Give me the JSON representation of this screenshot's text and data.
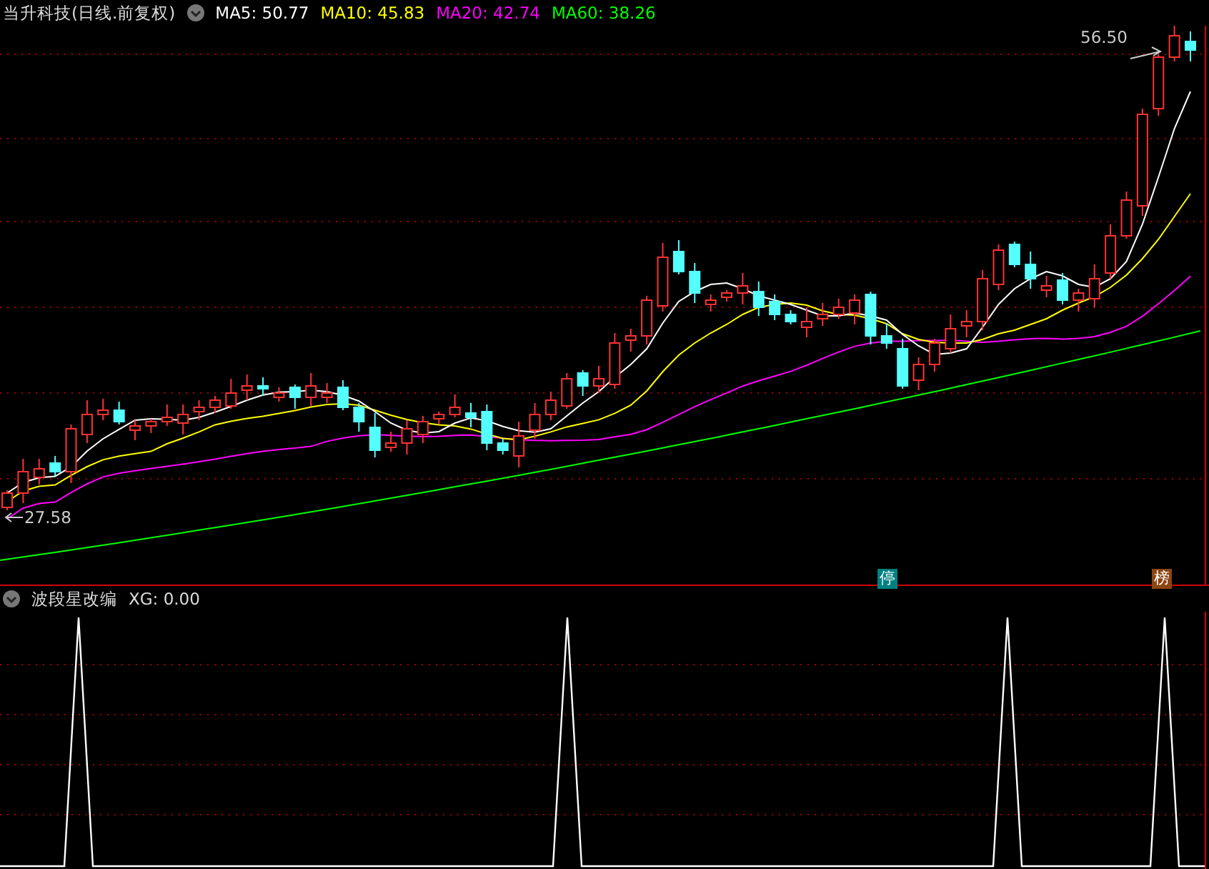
{
  "header": {
    "title": "当升科技(日线.前复权)",
    "ma": [
      {
        "label": "MA5: 50.77",
        "color": "#ffffff"
      },
      {
        "label": "MA10: 45.83",
        "color": "#ffff00"
      },
      {
        "label": "MA20: 42.74",
        "color": "#ff00ff"
      },
      {
        "label": "MA60: 38.26",
        "color": "#00ff00"
      }
    ]
  },
  "price_chart": {
    "high_label": "56.50",
    "low_label": "27.58",
    "tags": [
      {
        "text": "停",
        "color": "#008080"
      },
      {
        "text": "榜",
        "color": "#8b4513"
      }
    ]
  },
  "indicator": {
    "name": "波段星改编",
    "reading": "XG: 0.00"
  }
}
